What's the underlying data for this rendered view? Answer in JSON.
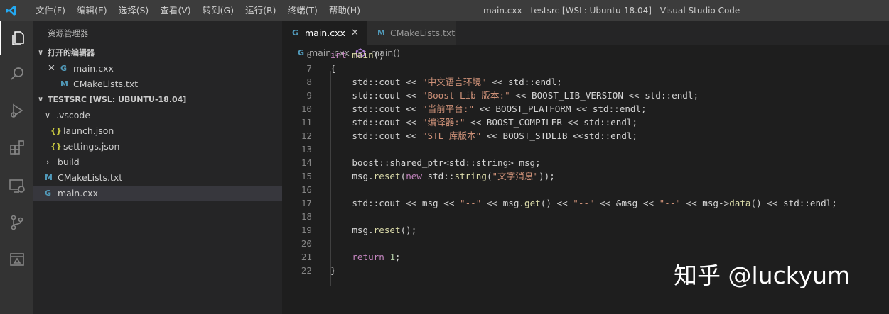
{
  "titlebar": {
    "menu": [
      "文件(F)",
      "编辑(E)",
      "选择(S)",
      "查看(V)",
      "转到(G)",
      "运行(R)",
      "终端(T)",
      "帮助(H)"
    ],
    "window_title": "main.cxx - testsrc [WSL: Ubuntu-18.04] - Visual Studio Code"
  },
  "sidebar": {
    "title": "资源管理器",
    "open_editors": {
      "label": "打开的编辑器",
      "items": [
        {
          "name": "main.cxx",
          "icon": "C++"
        },
        {
          "name": "CMakeLists.txt",
          "icon": "M"
        }
      ]
    },
    "workspace": {
      "label": "TESTSRC [WSL: UBUNTU-18.04]",
      "items": [
        {
          "name": ".vscode",
          "icon": "folder"
        },
        {
          "name": "launch.json",
          "icon": "{ }"
        },
        {
          "name": "settings.json",
          "icon": "{ }"
        },
        {
          "name": "build",
          "icon": "folder"
        },
        {
          "name": "CMakeLists.txt",
          "icon": "M"
        },
        {
          "name": "main.cxx",
          "icon": "C++"
        }
      ]
    }
  },
  "tabs": [
    {
      "label": "main.cxx",
      "close": "✕"
    },
    {
      "label": "CMakeLists.txt"
    }
  ],
  "breadcrumb": {
    "file": "main.cxx",
    "symbol": "main()"
  },
  "code": [
    {
      "n": "6",
      "parts": [
        [
          "kw",
          "int "
        ],
        [
          "fn",
          "main"
        ],
        [
          "p",
          "()"
        ]
      ]
    },
    {
      "n": "7",
      "parts": [
        [
          "p",
          "{"
        ]
      ]
    },
    {
      "n": "8",
      "parts": [
        [
          "p",
          "    std::cout << "
        ],
        [
          "str",
          "\"中文语言环境\""
        ],
        [
          "p",
          " << std::endl;"
        ]
      ]
    },
    {
      "n": "9",
      "parts": [
        [
          "p",
          "    std::cout << "
        ],
        [
          "str",
          "\"Boost Lib 版本:\""
        ],
        [
          "p",
          " << BOOST_LIB_VERSION << std::endl;"
        ]
      ]
    },
    {
      "n": "10",
      "parts": [
        [
          "p",
          "    std::cout << "
        ],
        [
          "str",
          "\"当前平台:\""
        ],
        [
          "p",
          " << BOOST_PLATFORM << std::endl;"
        ]
      ]
    },
    {
      "n": "11",
      "parts": [
        [
          "p",
          "    std::cout << "
        ],
        [
          "str",
          "\"编译器:\""
        ],
        [
          "p",
          " << BOOST_COMPILER << std::endl;"
        ]
      ]
    },
    {
      "n": "12",
      "parts": [
        [
          "p",
          "    std::cout << "
        ],
        [
          "str",
          "\"STL 库版本\""
        ],
        [
          "p",
          " << BOOST_STDLIB <<std::endl;"
        ]
      ]
    },
    {
      "n": "13",
      "parts": [
        [
          "p",
          ""
        ]
      ]
    },
    {
      "n": "14",
      "parts": [
        [
          "p",
          "    boost::shared_ptr<std::string> msg;"
        ]
      ]
    },
    {
      "n": "15",
      "parts": [
        [
          "p",
          "    msg."
        ],
        [
          "fn",
          "reset"
        ],
        [
          "p",
          "("
        ],
        [
          "kw",
          "new"
        ],
        [
          "p",
          " std::"
        ],
        [
          "fn",
          "string"
        ],
        [
          "p",
          "("
        ],
        [
          "str",
          "\"文字消息\""
        ],
        [
          "p",
          "));"
        ]
      ]
    },
    {
      "n": "16",
      "parts": [
        [
          "p",
          ""
        ]
      ]
    },
    {
      "n": "17",
      "parts": [
        [
          "p",
          "    std::cout << msg << "
        ],
        [
          "str",
          "\"--\""
        ],
        [
          "p",
          " << msg."
        ],
        [
          "fn",
          "get"
        ],
        [
          "p",
          "() << "
        ],
        [
          "str",
          "\"--\""
        ],
        [
          "p",
          " << &msg << "
        ],
        [
          "str",
          "\"--\""
        ],
        [
          "p",
          " << msg->"
        ],
        [
          "fn",
          "data"
        ],
        [
          "p",
          "() << std::endl;"
        ]
      ]
    },
    {
      "n": "18",
      "parts": [
        [
          "p",
          ""
        ]
      ]
    },
    {
      "n": "19",
      "parts": [
        [
          "p",
          "    msg."
        ],
        [
          "fn",
          "reset"
        ],
        [
          "p",
          "();"
        ]
      ]
    },
    {
      "n": "20",
      "parts": [
        [
          "p",
          ""
        ]
      ]
    },
    {
      "n": "21",
      "parts": [
        [
          "p",
          "    "
        ],
        [
          "kw",
          "return"
        ],
        [
          "p",
          " "
        ],
        [
          "num",
          "1"
        ],
        [
          "p",
          ";"
        ]
      ]
    },
    {
      "n": "22",
      "parts": [
        [
          "p",
          "}"
        ]
      ]
    }
  ],
  "watermark": "知乎 @luckyum"
}
